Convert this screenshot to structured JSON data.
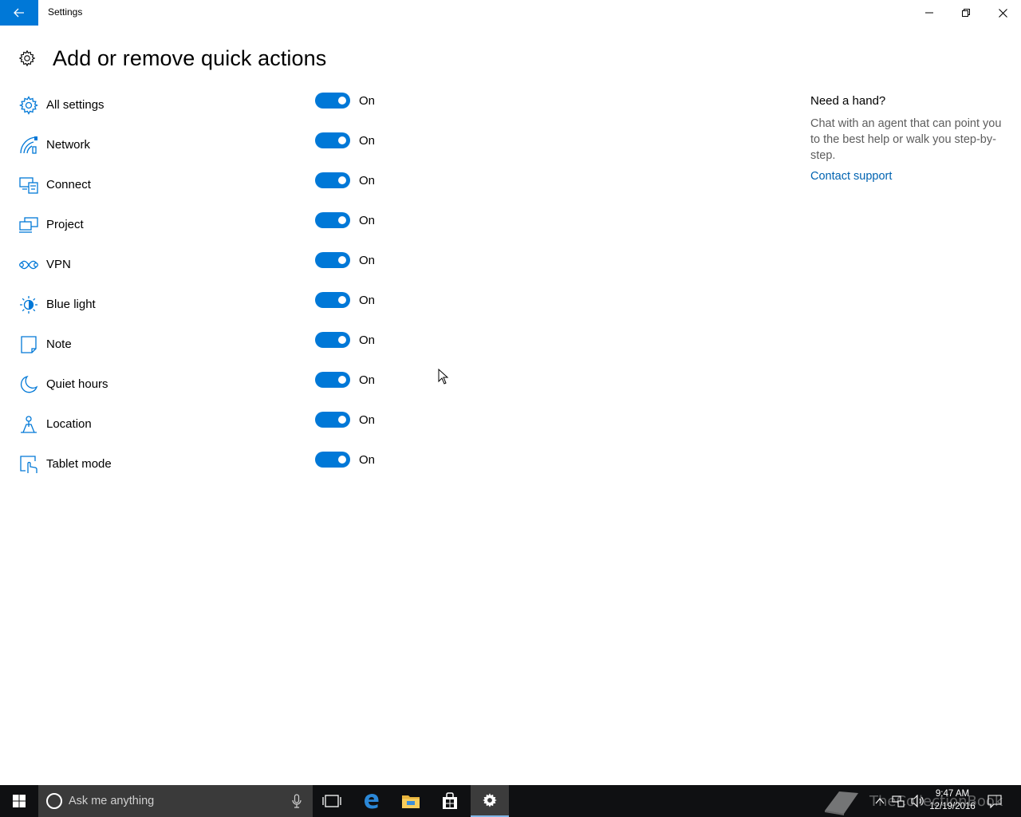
{
  "window": {
    "title": "Settings",
    "back_icon": "arrow-left-icon",
    "controls": [
      "minimize-icon",
      "restore-icon",
      "close-icon"
    ]
  },
  "page": {
    "title": "Add or remove quick actions",
    "title_icon": "gear-icon"
  },
  "actions": [
    {
      "label": "All settings",
      "icon": "gear-icon",
      "state": "On",
      "enabled": true
    },
    {
      "label": "Network",
      "icon": "network-icon",
      "state": "On",
      "enabled": true
    },
    {
      "label": "Connect",
      "icon": "connect-icon",
      "state": "On",
      "enabled": true
    },
    {
      "label": "Project",
      "icon": "project-icon",
      "state": "On",
      "enabled": true
    },
    {
      "label": "VPN",
      "icon": "vpn-icon",
      "state": "On",
      "enabled": true
    },
    {
      "label": "Blue light",
      "icon": "brightness-icon",
      "state": "On",
      "enabled": true
    },
    {
      "label": "Note",
      "icon": "note-icon",
      "state": "On",
      "enabled": true
    },
    {
      "label": "Quiet hours",
      "icon": "moon-icon",
      "state": "On",
      "enabled": true
    },
    {
      "label": "Location",
      "icon": "location-icon",
      "state": "On",
      "enabled": true
    },
    {
      "label": "Tablet mode",
      "icon": "tablet-mode-icon",
      "state": "On",
      "enabled": true
    }
  ],
  "help": {
    "title": "Need a hand?",
    "text": "Chat with an agent that can point you to the best help or walk you step-by-step.",
    "link": "Contact support"
  },
  "taskbar": {
    "search_placeholder": "Ask me anything",
    "time": "9:47 AM",
    "date": "12/19/2016",
    "watermark": "TheCollectionBook",
    "pinned": [
      "task-view-icon",
      "edge-icon",
      "file-explorer-icon",
      "store-icon",
      "settings-icon"
    ]
  },
  "colors": {
    "accent": "#0078d7",
    "link": "#0063b1",
    "taskbar": "#0f1012"
  }
}
